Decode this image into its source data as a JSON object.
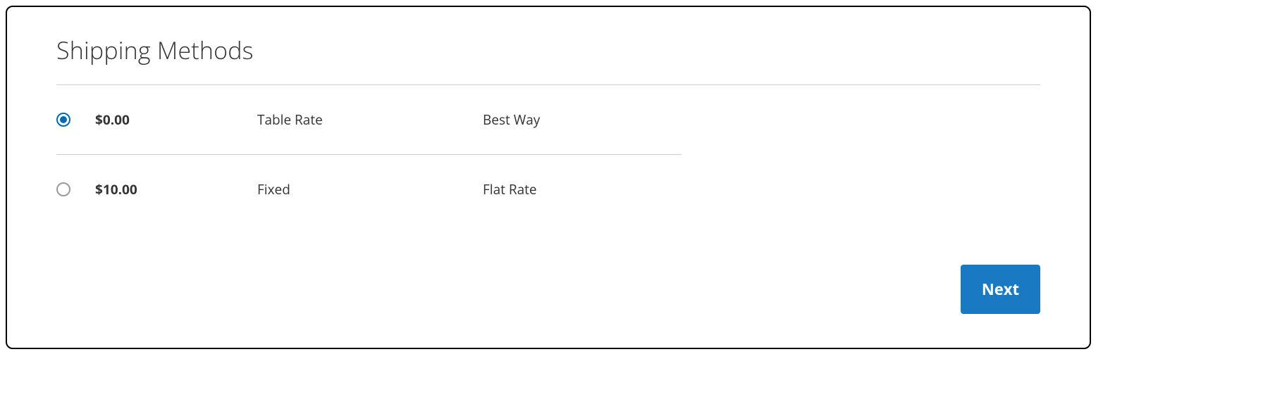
{
  "section": {
    "title": "Shipping Methods"
  },
  "methods": [
    {
      "selected": true,
      "price": "$0.00",
      "method": "Table Rate",
      "carrier": "Best Way"
    },
    {
      "selected": false,
      "price": "$10.00",
      "method": "Fixed",
      "carrier": "Flat Rate"
    }
  ],
  "actions": {
    "next_label": "Next"
  }
}
